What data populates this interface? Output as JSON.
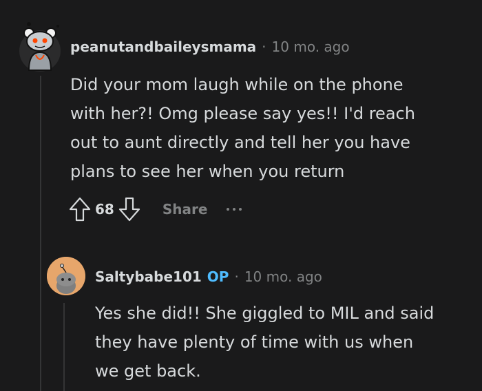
{
  "comment1": {
    "username": "peanutandbaileysmama",
    "separator": "·",
    "time": "10 mo. ago",
    "lines": [
      "Did your mom laugh while on the phone",
      "with her?! Omg please say yes!! I'd reach",
      "out to aunt directly and tell her you have",
      "plans to see her when you return"
    ],
    "score": "68",
    "share_label": "Share",
    "upvote_icon": "upvote-arrow-icon",
    "downvote_icon": "downvote-arrow-icon",
    "more_icon": "more-options-icon"
  },
  "comment2": {
    "username": "Saltybabe101",
    "op_badge": "OP",
    "separator": "·",
    "time": "10 mo. ago",
    "lines": [
      "Yes she did!! She giggled to MIL and said",
      "they have plenty of time with us when",
      "we get back."
    ]
  },
  "colors": {
    "background": "#1a1a1b",
    "text": "#d7dadc",
    "muted": "#818384",
    "op": "#4fbcff",
    "thread_line": "#343536",
    "avatar2_bg": "#e7a66b"
  }
}
